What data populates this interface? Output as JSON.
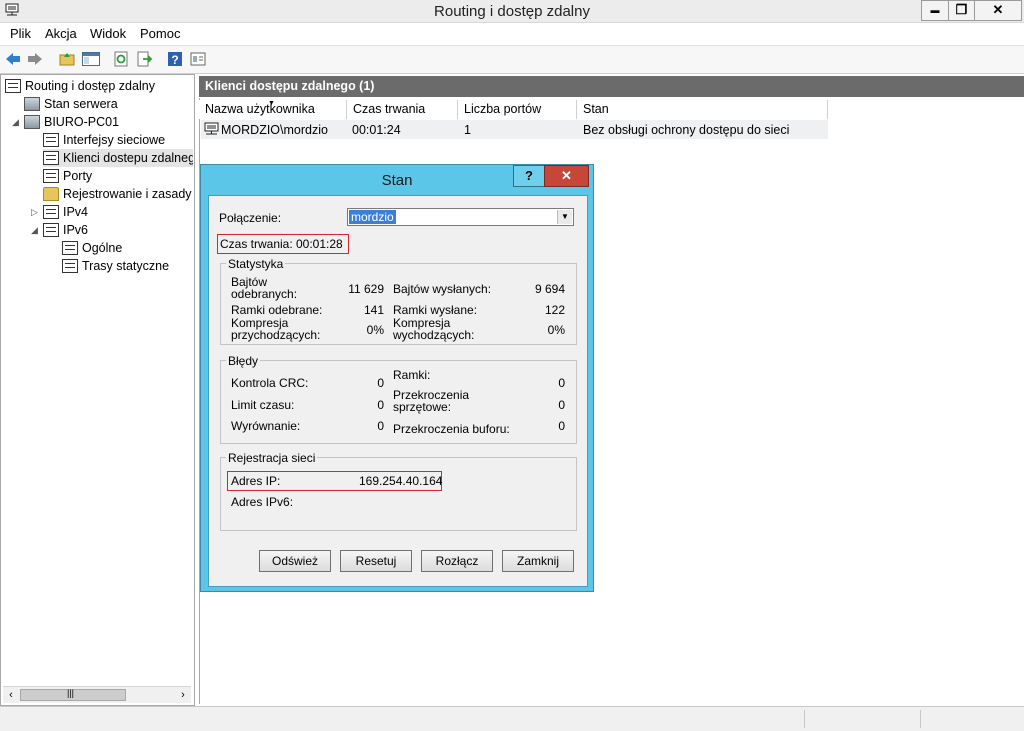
{
  "window": {
    "title": "Routing i dostęp zdalny",
    "controls": [
      "▬",
      "❐",
      "✕"
    ]
  },
  "menu": [
    "Plik",
    "Akcja",
    "Widok",
    "Pomoc"
  ],
  "toolbar_icons": [
    "back-arrow-icon",
    "forward-arrow-icon",
    "up-folder-icon",
    "show-hide-tree-icon",
    "refresh-icon",
    "export-icon",
    "help-icon",
    "properties-icon"
  ],
  "tree": {
    "root": "Routing i dostęp zdalny",
    "server_status": "Stan serwera",
    "server": "BIURO-PC01",
    "interfaces": "Interfejsy sieciowe",
    "remote_clients": "Klienci dostepu zdalnego",
    "ports": "Porty",
    "logging": "Rejestrowanie i zasady d",
    "ipv4": "IPv4",
    "ipv6": "IPv6",
    "general": "Ogólne",
    "static_routes": "Trasy statyczne"
  },
  "panel": {
    "header": "Klienci dostępu zdalnego (1)",
    "columns": [
      "Nazwa użytkownika",
      "Czas trwania",
      "Liczba portów",
      "Stan"
    ],
    "rows": [
      [
        "MORDZIO\\mordzio",
        "00:01:24",
        "1",
        "Bez obsługi ochrony dostępu do sieci"
      ]
    ]
  },
  "dialog": {
    "title": "Stan",
    "help": "?",
    "close": "✕",
    "connection_label": "Połączenie:",
    "connection_value": "mordzio",
    "duration_label": "Czas trwania:",
    "duration_value": "00:01:28",
    "stats": {
      "title": "Statystyka",
      "bytes_in_label": "Bajtów odebranych:",
      "bytes_in": "11 629",
      "bytes_out_label": "Bajtów wysłanych:",
      "bytes_out": "9 694",
      "frames_in_label": "Ramki odebrane:",
      "frames_in": "141",
      "frames_out_label": "Ramki wysłane:",
      "frames_out": "122",
      "comp_in_label": "Kompresja przychodzących:",
      "comp_in": "0%",
      "comp_out_label": "Kompresja wychodzących:",
      "comp_out": "0%"
    },
    "errors": {
      "title": "Błędy",
      "crc_label": "Kontrola CRC:",
      "crc": "0",
      "timeout_label": "Limit czasu:",
      "timeout": "0",
      "alignment_label": "Wyrównanie:",
      "alignment": "0",
      "frames_label": "Ramki:",
      "frames": "0",
      "hw_overrun_label": "Przekroczenia sprzętowe:",
      "hw_overrun": "0",
      "buffer_overrun_label": "Przekroczenia buforu:",
      "buffer_overrun": "0"
    },
    "network": {
      "title": "Rejestracja sieci",
      "ip_label": "Adres IP:",
      "ip": "169.254.40.164",
      "ipv6_label": "Adres IPv6:",
      "ipv6": ""
    },
    "buttons": {
      "refresh": "Odśwież",
      "reset": "Resetuj",
      "disconnect": "Rozłącz",
      "close": "Zamknij"
    }
  },
  "colors": {
    "dialog_frame": "#5cc6e8",
    "close_button": "#c6463a",
    "highlight_box": "#d6262b",
    "panel_header": "#6b6b6b"
  }
}
